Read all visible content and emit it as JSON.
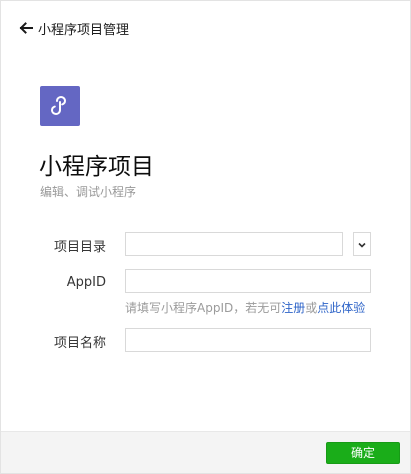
{
  "header": {
    "back_icon": "arrow-left-icon",
    "title": "小程序项目管理"
  },
  "logo": {
    "icon": "miniprogram-logo-icon",
    "bg_color": "#6467c3"
  },
  "page": {
    "title": "小程序项目",
    "subtitle": "编辑、调试小程序"
  },
  "form": {
    "project_dir": {
      "label": "项目目录",
      "value": "",
      "dropdown_icon": "chevron-down-icon"
    },
    "appid": {
      "label": "AppID",
      "value": "",
      "hint_prefix": "请填写小程序AppID，若无可",
      "hint_register": "注册",
      "hint_or": "或",
      "hint_experience": "点此体验"
    },
    "project_name": {
      "label": "项目名称",
      "value": ""
    }
  },
  "footer": {
    "confirm_label": "确定"
  },
  "colors": {
    "primary_button": "#1aad19",
    "link": "#2e64c8"
  }
}
